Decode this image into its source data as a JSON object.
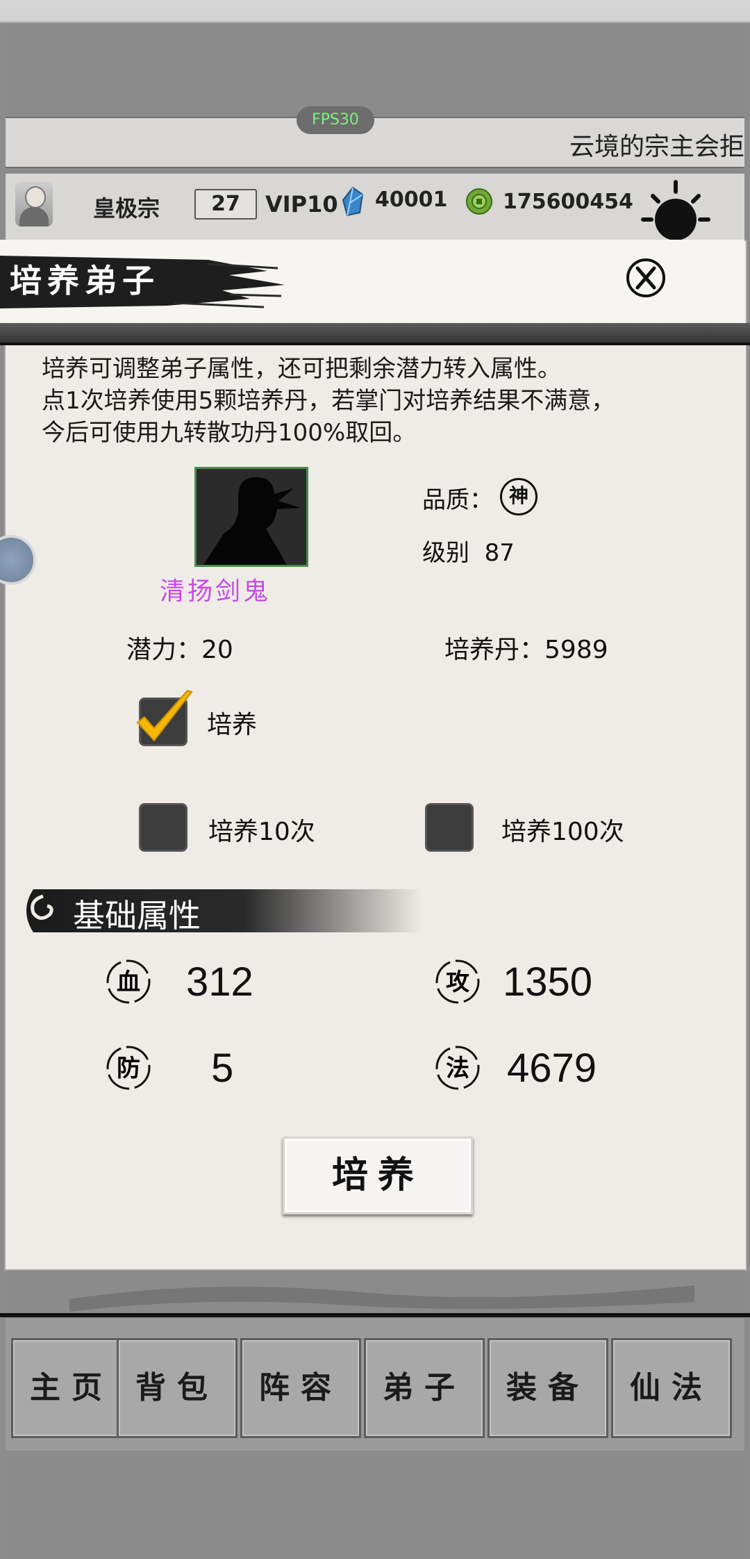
{
  "fps": "FPS30",
  "marquee": "云境的宗主会拒",
  "status": {
    "sect_name": "皇极宗",
    "level": "27",
    "vip": "VIP10",
    "gems": "40001",
    "coins": "175600454"
  },
  "panel": {
    "title": "培养弟子",
    "description": [
      "培养可调整弟子属性，还可把剩余潜力转入属性。",
      "点1次培养使用5颗培养丹，若掌门对培养结果不满意，",
      "今后可使用九转散功丹100%取回。"
    ],
    "disciple_name": "清扬剑鬼",
    "quality_label": "品质：",
    "quality_value": "神",
    "level_label": "级别",
    "level_value": "87",
    "potential_label": "潜力：",
    "potential_value": "20",
    "pills_label": "培养丹：",
    "pills_value": "5989",
    "options": [
      {
        "label": "培养",
        "checked": true
      },
      {
        "label": "培养10次",
        "checked": false
      },
      {
        "label": "培养100次",
        "checked": false
      }
    ],
    "section_title": "基础属性",
    "stats": {
      "hp": {
        "icon": "血",
        "value": "312"
      },
      "atk": {
        "icon": "攻",
        "value": "1350"
      },
      "def": {
        "icon": "防",
        "value": "5"
      },
      "magic": {
        "icon": "法",
        "value": "4679"
      }
    },
    "train_button": "培养"
  },
  "nav": [
    "主页",
    "背包",
    "阵容",
    "弟子",
    "装备",
    "仙法"
  ],
  "colors": {
    "name": "#c74ae8",
    "fps": "#7df07d",
    "check": "#f6b800"
  }
}
